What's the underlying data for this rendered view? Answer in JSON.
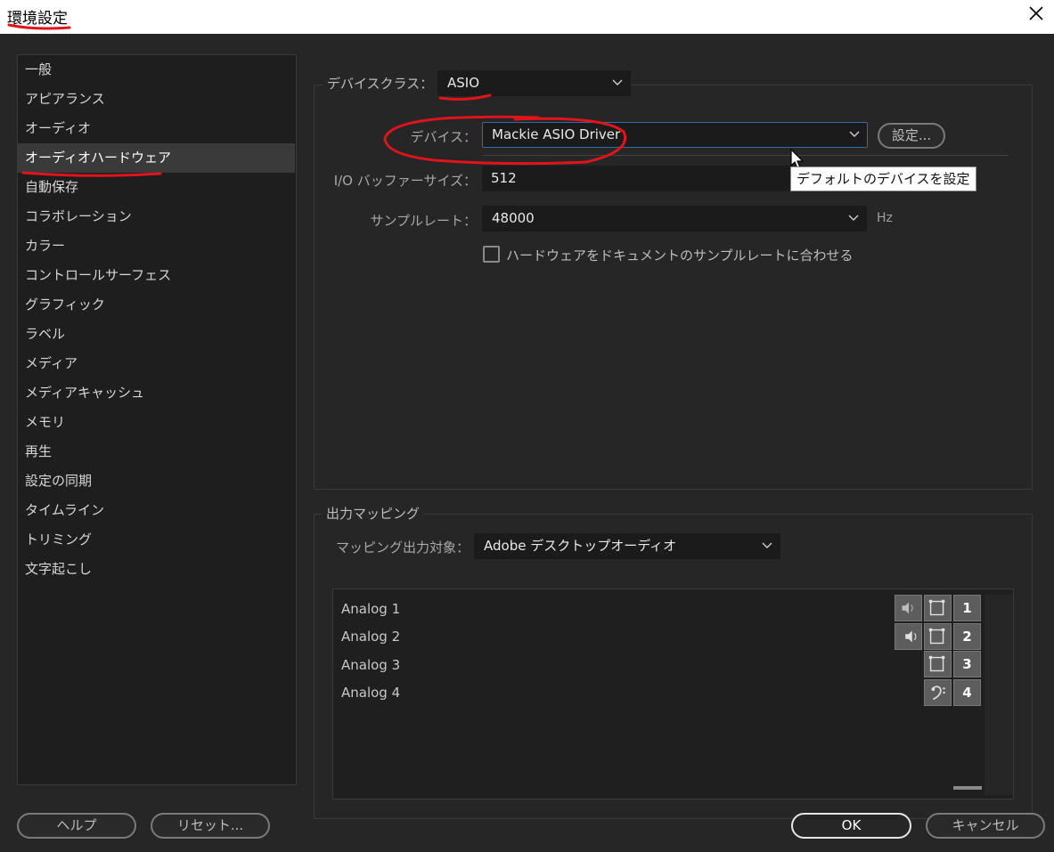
{
  "window": {
    "title": "環境設定"
  },
  "sidebar": {
    "items": [
      {
        "label": "一般"
      },
      {
        "label": "アピアランス"
      },
      {
        "label": "オーディオ"
      },
      {
        "label": "オーディオハードウェア",
        "selected": true
      },
      {
        "label": "自動保存"
      },
      {
        "label": "コラボレーション"
      },
      {
        "label": "カラー"
      },
      {
        "label": "コントロールサーフェス"
      },
      {
        "label": "グラフィック"
      },
      {
        "label": "ラベル"
      },
      {
        "label": "メディア"
      },
      {
        "label": "メディアキャッシュ"
      },
      {
        "label": "メモリ"
      },
      {
        "label": "再生"
      },
      {
        "label": "設定の同期"
      },
      {
        "label": "タイムライン"
      },
      {
        "label": "トリミング"
      },
      {
        "label": "文字起こし"
      }
    ]
  },
  "device_class": {
    "label": "デバイスクラス：",
    "value": "ASIO"
  },
  "device": {
    "label": "デバイス：",
    "value": "Mackie ASIO Driver",
    "settings_button": "設定..."
  },
  "tooltip": "デフォルトのデバイスを設定",
  "buffer": {
    "label": "I/O バッファーサイズ：",
    "value": "512"
  },
  "sample_rate": {
    "label": "サンプルレート：",
    "value": "48000",
    "unit": "Hz"
  },
  "match_checkbox": {
    "label": "ハードウェアをドキュメントのサンプルレートに合わせる",
    "checked": false
  },
  "output_mapping": {
    "legend": "出力マッピング",
    "target_label": "マッピング出力対象：",
    "target_value": "Adobe デスクトップオーディオ",
    "rows": [
      {
        "name": "Analog 1",
        "channel": "1"
      },
      {
        "name": "Analog 2",
        "channel": "2"
      },
      {
        "name": "Analog 3",
        "channel": "3"
      },
      {
        "name": "Analog 4",
        "channel": "4"
      }
    ]
  },
  "buttons": {
    "help": "ヘルプ",
    "reset": "リセット...",
    "ok": "OK",
    "cancel": "キャンセル"
  },
  "colors": {
    "annotation": "#e0141b",
    "focus": "#2d6db6",
    "background": "#262626"
  }
}
